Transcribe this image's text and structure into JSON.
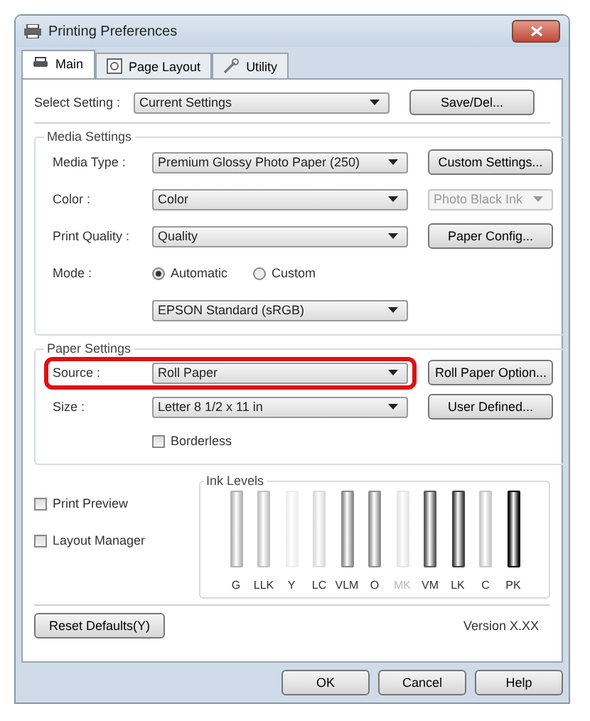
{
  "window": {
    "title": "Printing Preferences"
  },
  "tabs": [
    {
      "label": "Main",
      "selected": true
    },
    {
      "label": "Page Layout",
      "selected": false
    },
    {
      "label": "Utility",
      "selected": false
    }
  ],
  "select_setting": {
    "label": "Select Setting :",
    "value": "Current Settings",
    "button": "Save/Del..."
  },
  "media_settings": {
    "title": "Media Settings",
    "rows": [
      {
        "label": "Media Type :",
        "value": "Premium Glossy Photo Paper (250)",
        "side": {
          "kind": "button",
          "text": "Custom Settings..."
        }
      },
      {
        "label": "Color :",
        "value": "Color",
        "side": {
          "kind": "dropdown",
          "text": "Photo Black Ink",
          "disabled": true
        }
      },
      {
        "label": "Print Quality :",
        "value": "Quality",
        "side": {
          "kind": "button",
          "text": "Paper Config..."
        }
      }
    ],
    "mode": {
      "label": "Mode :",
      "options": [
        {
          "label": "Automatic",
          "selected": true
        },
        {
          "label": "Custom",
          "selected": false
        }
      ],
      "value": "EPSON Standard (sRGB)"
    }
  },
  "paper_settings": {
    "title": "Paper Settings",
    "rows": [
      {
        "label": "Source :",
        "value": "Roll Paper",
        "highlighted": true,
        "button": "Roll Paper Option..."
      },
      {
        "label": "Size :",
        "value": "Letter 8 1/2 x 11 in",
        "highlighted": false,
        "button": "User Defined..."
      }
    ],
    "borderless": {
      "label": "Borderless",
      "checked": false
    }
  },
  "options": [
    {
      "label": "Print Preview",
      "checked": false
    },
    {
      "label": "Layout Manager",
      "checked": false
    }
  ],
  "ink_levels": {
    "title": "Ink Levels",
    "inks": [
      {
        "label": "G",
        "color": "#b4b4b4",
        "disabled": false
      },
      {
        "label": "LLK",
        "color": "#c4c4c4",
        "disabled": false
      },
      {
        "label": "Y",
        "color": "#eeeeee",
        "disabled": false
      },
      {
        "label": "LC",
        "color": "#dcdcdc",
        "disabled": false
      },
      {
        "label": "VLM",
        "color": "#8c8c8c",
        "disabled": false
      },
      {
        "label": "O",
        "color": "#909090",
        "disabled": false
      },
      {
        "label": "MK",
        "color": "#e6e6e6",
        "disabled": true
      },
      {
        "label": "VM",
        "color": "#5a5a5a",
        "disabled": false
      },
      {
        "label": "LK",
        "color": "#404040",
        "disabled": false
      },
      {
        "label": "C",
        "color": "#c8c8c8",
        "disabled": false
      },
      {
        "label": "PK",
        "color": "#000000",
        "disabled": false
      }
    ]
  },
  "reset_button": "Reset Defaults(Y)",
  "version": "Version X.XX",
  "buttons": [
    "OK",
    "Cancel",
    "Help"
  ]
}
